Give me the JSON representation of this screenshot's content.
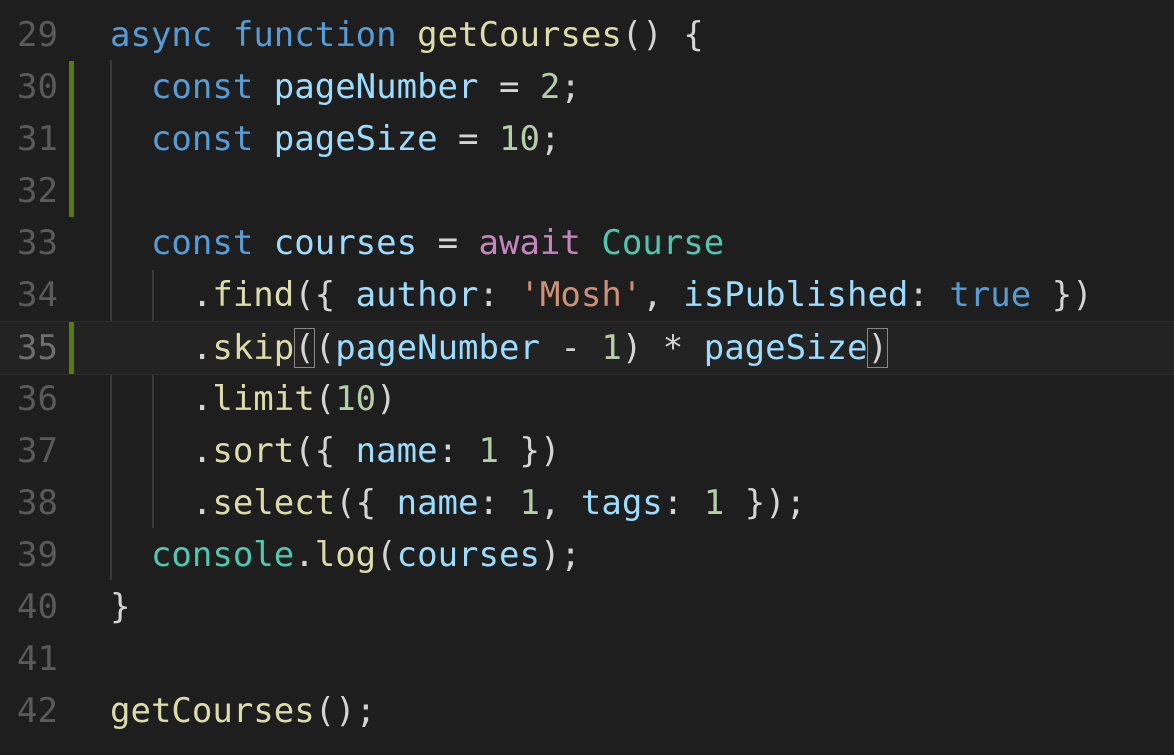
{
  "editor": {
    "lines": [
      {
        "number": "29",
        "tokens": [
          {
            "t": "async",
            "c": "kw"
          },
          {
            "t": " ",
            "c": "pun"
          },
          {
            "t": "function",
            "c": "kw"
          },
          {
            "t": " ",
            "c": "pun"
          },
          {
            "t": "getCourses",
            "c": "fn"
          },
          {
            "t": "() {",
            "c": "pun"
          }
        ]
      },
      {
        "number": "30",
        "tokens": [
          {
            "t": "  ",
            "c": "pun"
          },
          {
            "t": "const",
            "c": "kw"
          },
          {
            "t": " ",
            "c": "pun"
          },
          {
            "t": "pageNumber",
            "c": "var"
          },
          {
            "t": " = ",
            "c": "pun"
          },
          {
            "t": "2",
            "c": "num"
          },
          {
            "t": ";",
            "c": "pun"
          }
        ]
      },
      {
        "number": "31",
        "tokens": [
          {
            "t": "  ",
            "c": "pun"
          },
          {
            "t": "const",
            "c": "kw"
          },
          {
            "t": " ",
            "c": "pun"
          },
          {
            "t": "pageSize",
            "c": "var"
          },
          {
            "t": " = ",
            "c": "pun"
          },
          {
            "t": "10",
            "c": "num"
          },
          {
            "t": ";",
            "c": "pun"
          }
        ]
      },
      {
        "number": "32",
        "tokens": []
      },
      {
        "number": "33",
        "tokens": [
          {
            "t": "  ",
            "c": "pun"
          },
          {
            "t": "const",
            "c": "kw"
          },
          {
            "t": " ",
            "c": "pun"
          },
          {
            "t": "courses",
            "c": "var"
          },
          {
            "t": " = ",
            "c": "pun"
          },
          {
            "t": "await",
            "c": "kw2"
          },
          {
            "t": " ",
            "c": "pun"
          },
          {
            "t": "Course",
            "c": "cls"
          }
        ]
      },
      {
        "number": "34",
        "tokens": [
          {
            "t": "    .",
            "c": "pun"
          },
          {
            "t": "find",
            "c": "fn"
          },
          {
            "t": "({ ",
            "c": "pun"
          },
          {
            "t": "author",
            "c": "var"
          },
          {
            "t": ": ",
            "c": "pun"
          },
          {
            "t": "'Mosh'",
            "c": "str"
          },
          {
            "t": ", ",
            "c": "pun"
          },
          {
            "t": "isPublished",
            "c": "var"
          },
          {
            "t": ": ",
            "c": "pun"
          },
          {
            "t": "true",
            "c": "kw"
          },
          {
            "t": " })",
            "c": "pun"
          }
        ]
      },
      {
        "number": "35",
        "tokens": [
          {
            "t": "    .",
            "c": "pun"
          },
          {
            "t": "skip",
            "c": "fn"
          },
          {
            "t": "(",
            "c": "pun",
            "box": true
          },
          {
            "t": "(",
            "c": "pun"
          },
          {
            "t": "pageNumber",
            "c": "var"
          },
          {
            "t": " - ",
            "c": "pun"
          },
          {
            "t": "1",
            "c": "num"
          },
          {
            "t": ") * ",
            "c": "pun"
          },
          {
            "t": "pageSize",
            "c": "var"
          },
          {
            "t": ")",
            "c": "pun",
            "box": true
          }
        ]
      },
      {
        "number": "36",
        "tokens": [
          {
            "t": "    .",
            "c": "pun"
          },
          {
            "t": "limit",
            "c": "fn"
          },
          {
            "t": "(",
            "c": "pun"
          },
          {
            "t": "10",
            "c": "num"
          },
          {
            "t": ")",
            "c": "pun"
          }
        ]
      },
      {
        "number": "37",
        "tokens": [
          {
            "t": "    .",
            "c": "pun"
          },
          {
            "t": "sort",
            "c": "fn"
          },
          {
            "t": "({ ",
            "c": "pun"
          },
          {
            "t": "name",
            "c": "var"
          },
          {
            "t": ": ",
            "c": "pun"
          },
          {
            "t": "1",
            "c": "num"
          },
          {
            "t": " })",
            "c": "pun"
          }
        ]
      },
      {
        "number": "38",
        "tokens": [
          {
            "t": "    .",
            "c": "pun"
          },
          {
            "t": "select",
            "c": "fn"
          },
          {
            "t": "({ ",
            "c": "pun"
          },
          {
            "t": "name",
            "c": "var"
          },
          {
            "t": ": ",
            "c": "pun"
          },
          {
            "t": "1",
            "c": "num"
          },
          {
            "t": ", ",
            "c": "pun"
          },
          {
            "t": "tags",
            "c": "var"
          },
          {
            "t": ": ",
            "c": "pun"
          },
          {
            "t": "1",
            "c": "num"
          },
          {
            "t": " });",
            "c": "pun"
          }
        ]
      },
      {
        "number": "39",
        "tokens": [
          {
            "t": "  ",
            "c": "pun"
          },
          {
            "t": "console",
            "c": "cls"
          },
          {
            "t": ".",
            "c": "pun"
          },
          {
            "t": "log",
            "c": "fn"
          },
          {
            "t": "(",
            "c": "pun"
          },
          {
            "t": "courses",
            "c": "var"
          },
          {
            "t": ");",
            "c": "pun"
          }
        ]
      },
      {
        "number": "40",
        "tokens": [
          {
            "t": "}",
            "c": "pun"
          }
        ]
      },
      {
        "number": "41",
        "tokens": []
      },
      {
        "number": "42",
        "tokens": [
          {
            "t": "getCourses",
            "c": "fn"
          },
          {
            "t": "();",
            "c": "pun"
          }
        ]
      }
    ],
    "active_line": "35",
    "modified_lines": [
      "30",
      "31",
      "32",
      "35"
    ]
  }
}
